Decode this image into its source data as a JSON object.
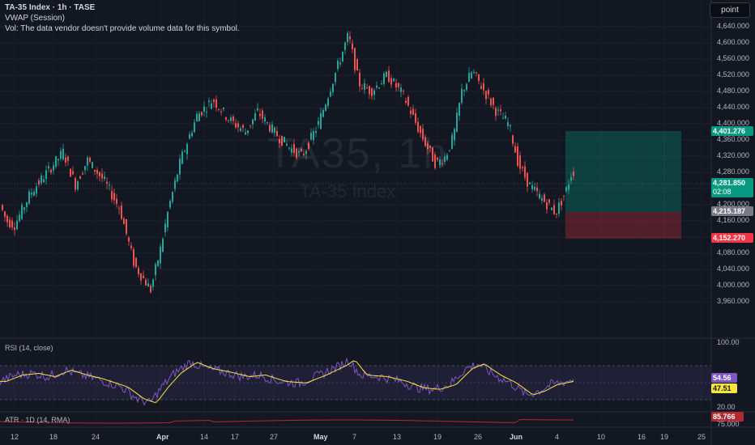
{
  "header": {
    "title": "TA-35 Index · 1h · TASE",
    "vwap": "VWAP (Session)",
    "vol": "Vol: The data vendor doesn't provide volume data for this symbol."
  },
  "toolbar": {
    "mode_label": "point"
  },
  "watermark": {
    "symbol": "TA35, 1h",
    "name": "TA-35 Index"
  },
  "price_axis": {
    "labels": [
      "4,640.000",
      "4,600.000",
      "4,560.000",
      "4,520.000",
      "4,480.000",
      "4,440.000",
      "4,400.000",
      "4,360.000",
      "4,320.000",
      "4,280.000",
      "4,240.000",
      "4,200.000",
      "4,160.000",
      "4,120.000",
      "4,080.000",
      "4,040.000",
      "4,000.000",
      "3,960.000"
    ]
  },
  "price_tags": {
    "target": "4,401.276",
    "current": "4,281.850",
    "countdown": "02:08",
    "entry": "4,215.187",
    "stop": "4,152.270"
  },
  "rsi": {
    "label": "RSI (14, close)",
    "value": "54.56",
    "ma_value": "47.51",
    "axis_top": "100.00",
    "axis_bottom": "20.00"
  },
  "atr": {
    "label": "ATR · 1D (14, RMA)",
    "value": "85.766",
    "axis": "75.000"
  },
  "time_axis": {
    "labels": [
      "12",
      "18",
      "24",
      "Apr",
      "14",
      "17",
      "27",
      "May",
      "7",
      "13",
      "19",
      "26",
      "Jun",
      "4",
      "10",
      "16",
      "19",
      "25"
    ]
  },
  "colors": {
    "background": "#131722",
    "up": "#26a69a",
    "down": "#ef5350",
    "target": "#089981",
    "stop": "#f23645",
    "rsi": "#7e57c2",
    "rsi_ma": "#f7e53b",
    "atr": "#b22833"
  },
  "chart_data": {
    "type": "candlestick",
    "symbol": "TA-35 Index",
    "interval": "1h",
    "ylim": [
      3950,
      4660
    ],
    "close_path": [
      {
        "date": "2024-03-08",
        "close": 4210
      },
      {
        "date": "2024-03-11",
        "close": 4160
      },
      {
        "date": "2024-03-12",
        "close": 4150
      },
      {
        "date": "2024-03-14",
        "close": 4230
      },
      {
        "date": "2024-03-17",
        "close": 4280
      },
      {
        "date": "2024-03-19",
        "close": 4330
      },
      {
        "date": "2024-03-21",
        "close": 4250
      },
      {
        "date": "2024-03-24",
        "close": 4310
      },
      {
        "date": "2024-03-26",
        "close": 4260
      },
      {
        "date": "2024-03-27",
        "close": 4190
      },
      {
        "date": "2024-03-28",
        "close": 4050
      },
      {
        "date": "2024-03-31",
        "close": 3990
      },
      {
        "date": "2024-04-01",
        "close": 4090
      },
      {
        "date": "2024-04-02",
        "close": 4190
      },
      {
        "date": "2024-04-04",
        "close": 4310
      },
      {
        "date": "2024-04-08",
        "close": 4420
      },
      {
        "date": "2024-04-10",
        "close": 4460
      },
      {
        "date": "2024-04-14",
        "close": 4410
      },
      {
        "date": "2024-04-16",
        "close": 4380
      },
      {
        "date": "2024-04-18",
        "close": 4430
      },
      {
        "date": "2024-04-21",
        "close": 4380
      },
      {
        "date": "2024-04-25",
        "close": 4340
      },
      {
        "date": "2024-04-28",
        "close": 4320
      },
      {
        "date": "2024-04-30",
        "close": 4400
      },
      {
        "date": "2024-05-02",
        "close": 4520
      },
      {
        "date": "2024-05-05",
        "close": 4620
      },
      {
        "date": "2024-05-07",
        "close": 4500
      },
      {
        "date": "2024-05-09",
        "close": 4480
      },
      {
        "date": "2024-05-12",
        "close": 4520
      },
      {
        "date": "2024-05-14",
        "close": 4470
      },
      {
        "date": "2024-05-16",
        "close": 4380
      },
      {
        "date": "2024-05-19",
        "close": 4300
      },
      {
        "date": "2024-05-21",
        "close": 4320
      },
      {
        "date": "2024-05-22",
        "close": 4370
      },
      {
        "date": "2024-05-23",
        "close": 4480
      },
      {
        "date": "2024-05-26",
        "close": 4530
      },
      {
        "date": "2024-05-28",
        "close": 4480
      },
      {
        "date": "2024-05-29",
        "close": 4430
      },
      {
        "date": "2024-05-30",
        "close": 4400
      },
      {
        "date": "2024-06-02",
        "close": 4300
      },
      {
        "date": "2024-06-03",
        "close": 4250
      },
      {
        "date": "2024-06-04",
        "close": 4220
      },
      {
        "date": "2024-06-05",
        "close": 4180
      },
      {
        "date": "2024-06-06",
        "close": 4281.85
      }
    ],
    "position": {
      "target": 4401.276,
      "entry": 4215.187,
      "stop": 4152.27
    },
    "rsi": {
      "last": 54.56,
      "ma_last": 47.51,
      "ylim": [
        20,
        100
      ]
    },
    "atr": {
      "last": 85.766
    }
  }
}
